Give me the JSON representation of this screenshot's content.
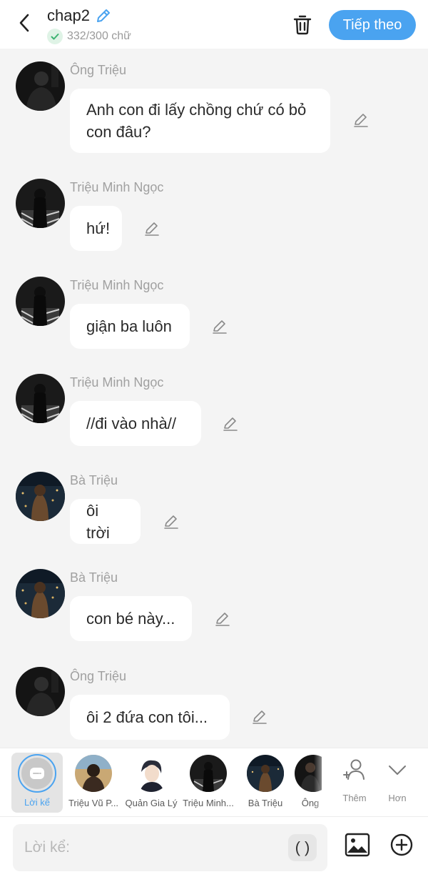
{
  "header": {
    "title": "chap2",
    "word_count": "332/300 chữ",
    "next_label": "Tiếp theo",
    "accent": "#4aa3f0"
  },
  "messages": [
    {
      "sender": "Ông Triệu",
      "text": "Anh con đi lấy chồng chứ có bỏ con đâu?"
    },
    {
      "sender": "Triệu Minh Ngọc",
      "text": "hứ!"
    },
    {
      "sender": "Triệu Minh Ngọc",
      "text": "giận ba luôn"
    },
    {
      "sender": "Triệu Minh Ngọc",
      "text": "//đi vào nhà//"
    },
    {
      "sender": "Bà Triệu",
      "text": "ôi trời"
    },
    {
      "sender": "Bà Triệu",
      "text": "con bé này..."
    },
    {
      "sender": "Ông Triệu",
      "text": "ôi 2 đứa con tôi..."
    }
  ],
  "characters": {
    "narrator": "Lời kể",
    "items": [
      "Triệu Vũ P...",
      "Quản Gia Lý",
      "Triệu Minh...",
      "Bà Triệu",
      "Ông"
    ],
    "add_label": "Thêm",
    "more_label": "Hơn"
  },
  "composer": {
    "placeholder": "Lời kể:",
    "paren_label": "( )"
  }
}
